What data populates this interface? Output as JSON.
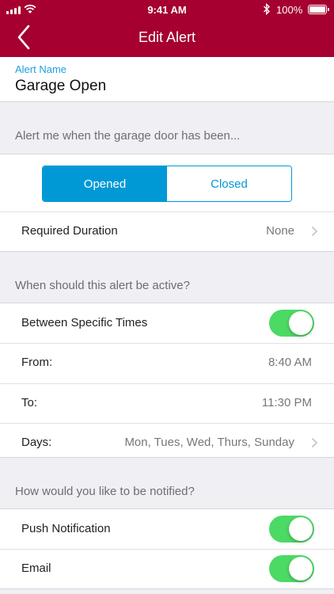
{
  "status_bar": {
    "time": "9:41 AM",
    "battery": "100%"
  },
  "nav": {
    "title": "Edit Alert",
    "back_icon": "chevron-left-icon"
  },
  "alert_name": {
    "label": "Alert Name",
    "value": "Garage Open"
  },
  "trigger": {
    "header": "Alert me when the garage door has been...",
    "options": [
      "Opened",
      "Closed"
    ],
    "selected": "Opened",
    "required_duration": {
      "label": "Required Duration",
      "value": "None"
    }
  },
  "schedule": {
    "header": "When should this alert be active?",
    "between_times": {
      "label": "Between Specific Times",
      "enabled": true
    },
    "from": {
      "label": "From:",
      "value": "8:40 AM"
    },
    "to": {
      "label": "To:",
      "value": "11:30 PM"
    },
    "days": {
      "label": "Days:",
      "value": "Mon, Tues, Wed, Thurs, Sunday"
    }
  },
  "notify": {
    "header": "How would you like to be notified?",
    "push": {
      "label": "Push Notification",
      "enabled": true
    },
    "email": {
      "label": "Email",
      "enabled": true
    }
  },
  "colors": {
    "brand": "#a5002f",
    "accent": "#0099d6",
    "toggle_on": "#4cd964",
    "label_blue": "#1ba1dc"
  }
}
